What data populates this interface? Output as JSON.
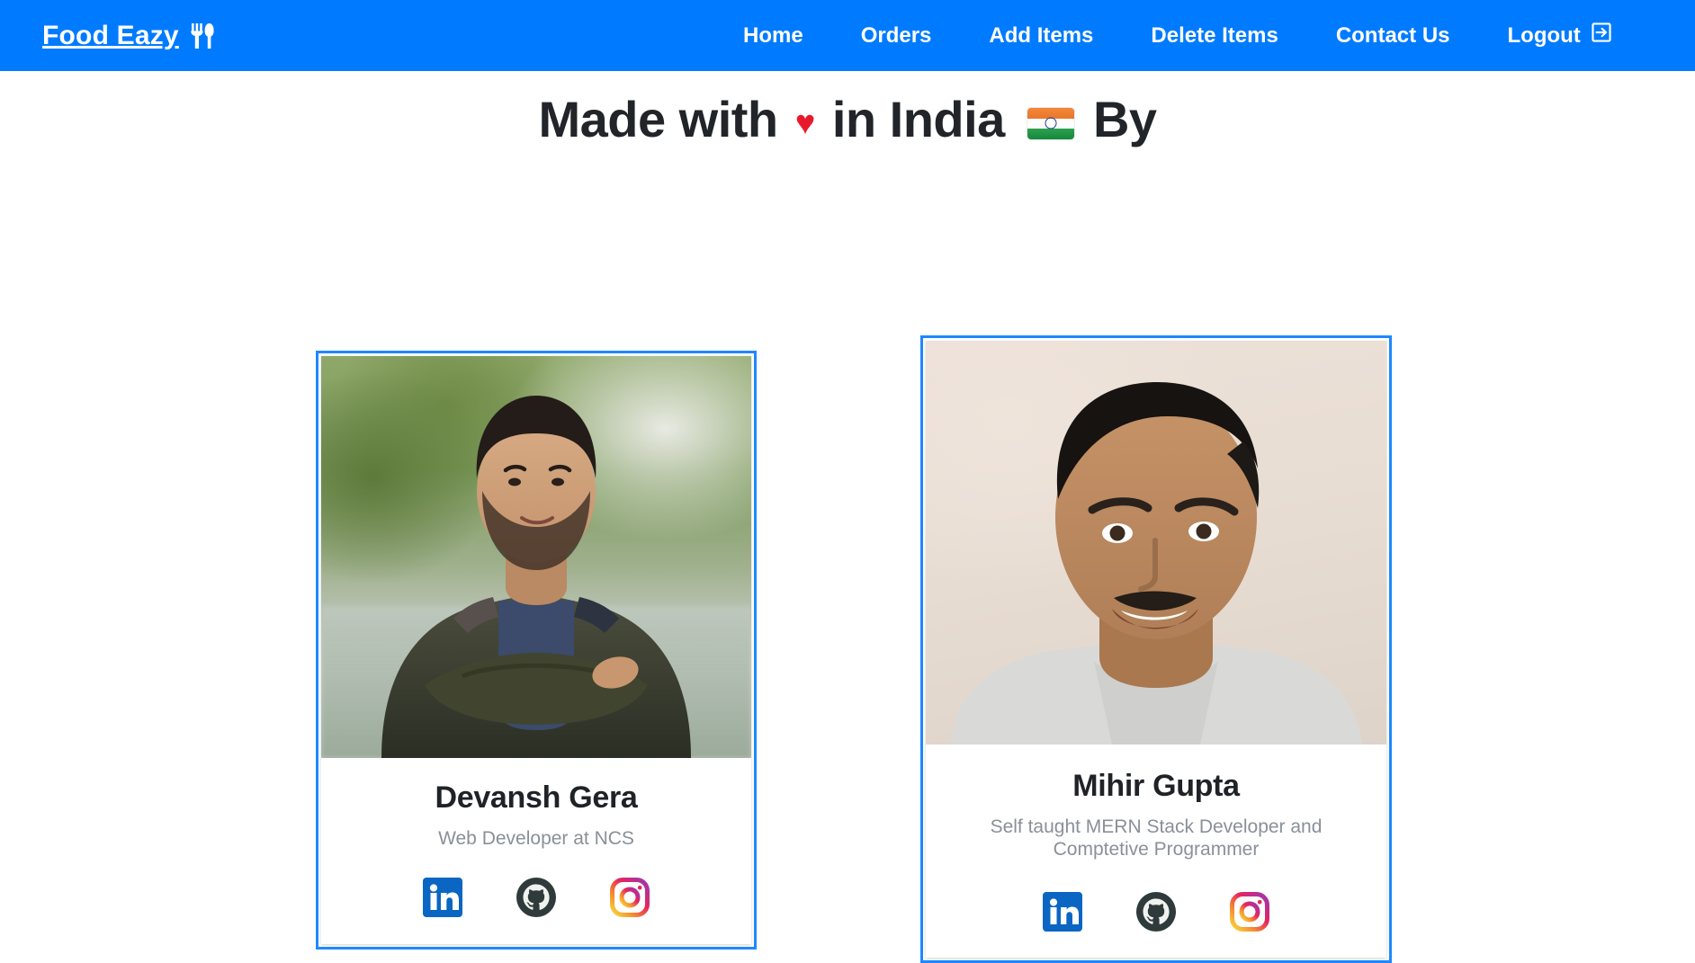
{
  "theme": {
    "navbar_bg": "#007bff",
    "card_border": "#1e88ff",
    "heading_color": "#212529",
    "role_color": "#8a9098",
    "heart_color": "#e8192c"
  },
  "navbar": {
    "brand": "Food Eazy",
    "brand_icon": "fork-and-knife-icon",
    "links": [
      {
        "label": "Home",
        "icon": null
      },
      {
        "label": "Orders",
        "icon": null
      },
      {
        "label": "Add Items",
        "icon": null
      },
      {
        "label": "Delete Items",
        "icon": null
      },
      {
        "label": "Contact Us",
        "icon": null
      },
      {
        "label": "Logout",
        "icon": "sign-out-icon"
      }
    ]
  },
  "heading": {
    "prefix": "Made with",
    "heart": "♥",
    "middle": "in India",
    "flag": "india-flag-icon",
    "suffix": "By",
    "full_text": "Made with ♥ in India 🇮🇳 By"
  },
  "cards": [
    {
      "name": "Devansh Gera",
      "role": "Web Developer at NCS",
      "photo_alt": "portrait of a man with arms crossed outdoors",
      "socials": [
        {
          "name": "linkedin-icon",
          "label": "LinkedIn",
          "color": "#0a66c2"
        },
        {
          "name": "github-icon",
          "label": "GitHub",
          "color": "#2f3b3a"
        },
        {
          "name": "instagram-icon",
          "label": "Instagram",
          "color": "#e1306c"
        }
      ]
    },
    {
      "name": "Mihir Gupta",
      "role": "Self taught MERN Stack Developer and Comptetive Programmer",
      "photo_alt": "close-up selfie portrait of a smiling man",
      "socials": [
        {
          "name": "linkedin-icon",
          "label": "LinkedIn",
          "color": "#0a66c2"
        },
        {
          "name": "github-icon",
          "label": "GitHub",
          "color": "#2f3b3a"
        },
        {
          "name": "instagram-icon",
          "label": "Instagram",
          "color": "#e1306c"
        }
      ]
    }
  ]
}
